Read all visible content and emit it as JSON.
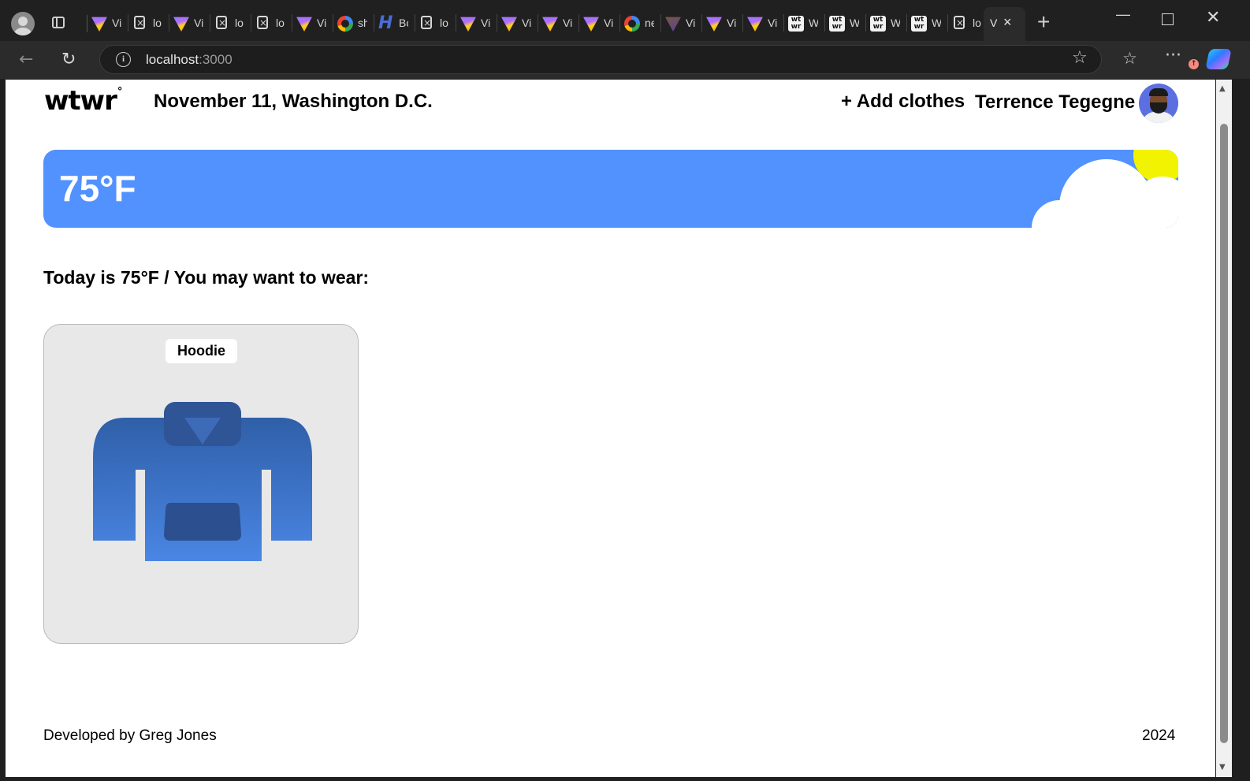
{
  "browser": {
    "tabs": [
      {
        "icon": "vite-icon",
        "title": "Vi"
      },
      {
        "icon": "file-error-icon",
        "title": "lo"
      },
      {
        "icon": "vite-icon",
        "title": "Vi"
      },
      {
        "icon": "file-error-icon",
        "title": "lo"
      },
      {
        "icon": "file-error-icon",
        "title": "lo"
      },
      {
        "icon": "vite-icon",
        "title": "Vi"
      },
      {
        "icon": "google-icon",
        "title": "sh"
      },
      {
        "icon": "h-icon",
        "title": "Bo"
      },
      {
        "icon": "file-error-icon",
        "title": "lo"
      },
      {
        "icon": "vite-icon",
        "title": "Vi"
      },
      {
        "icon": "vite-icon",
        "title": "Vi"
      },
      {
        "icon": "vite-icon",
        "title": "Vi"
      },
      {
        "icon": "vite-icon",
        "title": "Vi"
      },
      {
        "icon": "google-icon",
        "title": "ne"
      },
      {
        "icon": "vite-dark-icon",
        "title": "Vi"
      },
      {
        "icon": "vite-icon",
        "title": "Vi"
      },
      {
        "icon": "vite-icon",
        "title": "Vi"
      },
      {
        "icon": "wtwr-icon",
        "title": "W"
      },
      {
        "icon": "wtwr-icon",
        "title": "W"
      },
      {
        "icon": "wtwr-icon",
        "title": "W"
      },
      {
        "icon": "wtwr-icon",
        "title": "W"
      },
      {
        "icon": "file-error-icon",
        "title": "lo"
      }
    ],
    "active_tab": {
      "title": "V",
      "close": "×"
    },
    "new_tab": "+",
    "url_host": "localhost",
    "url_port": ":3000",
    "window_controls": {
      "minimize": "—",
      "close": "✕"
    },
    "toolbar_icons": {
      "back": "←",
      "reload": "↻",
      "star": "☆",
      "favorites": "☆",
      "more": "···",
      "update": "↑"
    }
  },
  "header": {
    "logo": "wtwr",
    "logo_degree": "°",
    "date_location": "November 11, Washington D.C.",
    "add_clothes": "+ Add clothes",
    "username": "Terrence Tegegne"
  },
  "weather": {
    "temperature": "75°F",
    "banner_color": "#5292ff",
    "sun_color": "#f2f300"
  },
  "main": {
    "recommendation": "Today is 75°F / You may want to wear:",
    "cards": [
      {
        "name": "Hoodie",
        "color": "#3f74c9"
      }
    ]
  },
  "footer": {
    "developer": "Developed by Greg Jones",
    "year": "2024"
  }
}
